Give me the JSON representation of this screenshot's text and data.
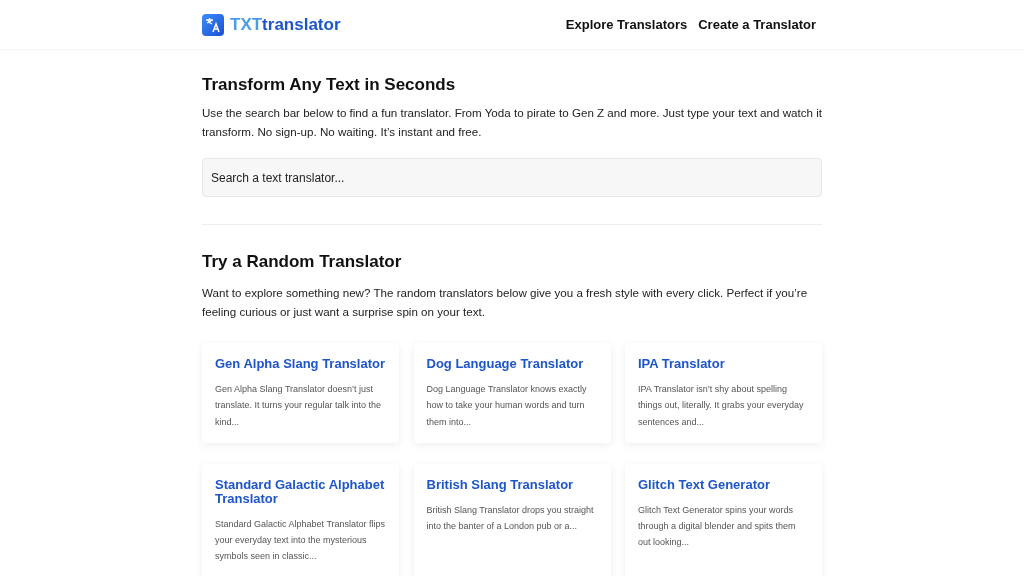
{
  "header": {
    "logo": {
      "prefix": "TXT",
      "name": "translator"
    },
    "nav": [
      {
        "label": "Explore Translators"
      },
      {
        "label": "Create a Translator"
      }
    ]
  },
  "hero": {
    "title": "Transform Any Text in Seconds",
    "intro": "Use the search bar below to find a fun translator. From Yoda to pirate to Gen Z and more. Just type your text and watch it transform. No sign-up. No waiting. It’s instant and free.",
    "search": {
      "placeholder": "Search a text translator..."
    }
  },
  "random": {
    "title": "Try a Random Translator",
    "intro": "Want to explore something new? The random translators below give you a fresh style with every click. Perfect if you’re feeling curious or just want a surprise spin on your text.",
    "cards": [
      {
        "title": "Gen Alpha Slang Translator",
        "excerpt": "Gen Alpha Slang Translator doesn’t just translate. It turns your regular talk into the kind..."
      },
      {
        "title": "Dog Language Translator",
        "excerpt": "Dog Language Translator knows exactly how to take your human words and turn them into..."
      },
      {
        "title": "IPA Translator",
        "excerpt": "IPA Translator isn’t shy about spelling things out, literally. It grabs your everyday sentences and..."
      },
      {
        "title": "Standard Galactic Alphabet Translator",
        "excerpt": "Standard Galactic Alphabet Translator flips your everyday text into the mysterious symbols seen in classic..."
      },
      {
        "title": "British Slang Translator",
        "excerpt": "British Slang Translator drops you straight into the banter of a London pub or a..."
      },
      {
        "title": "Glitch Text Generator",
        "excerpt": "Glitch Text Generator spins your words through a digital blender and spits them out looking..."
      }
    ]
  }
}
